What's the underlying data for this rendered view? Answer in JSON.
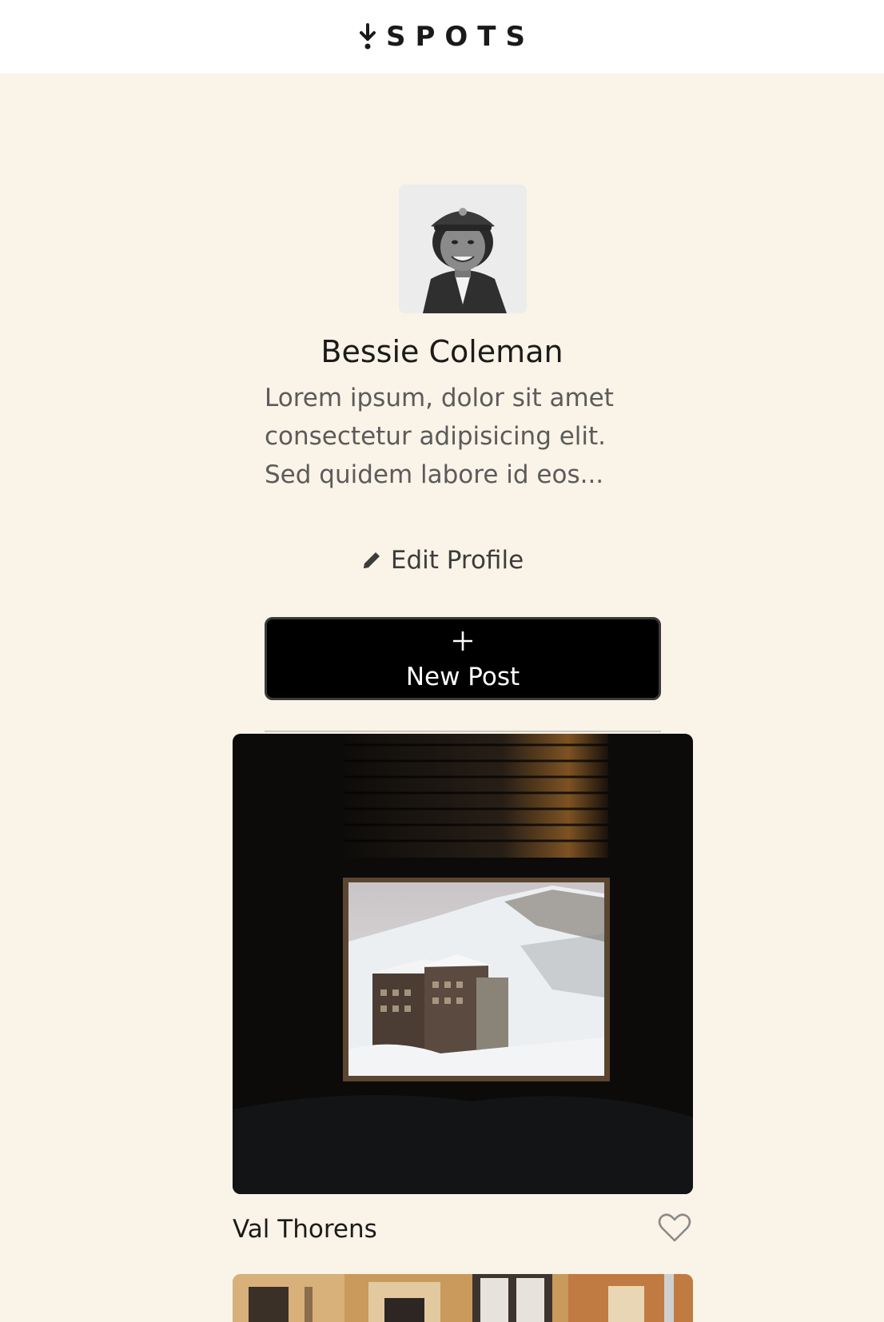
{
  "header": {
    "logo_text": "SPOTS",
    "logo_icon": "down-arrow-pin-icon"
  },
  "profile": {
    "name": "Bessie Coleman",
    "bio": "Lorem ipsum, dolor sit amet consectetur adipisicing elit. Sed quidem labore id eos...",
    "avatar_icon": "avatar-photo",
    "edit_label": "Edit Profile",
    "edit_icon": "pencil-icon"
  },
  "actions": {
    "new_post_label": "New Post",
    "new_post_icon": "plus-icon"
  },
  "cards": [
    {
      "title": "Val Thorens",
      "like_icon": "heart-outline-icon",
      "liked": false
    },
    {
      "title": "",
      "like_icon": "heart-outline-icon"
    }
  ],
  "colors": {
    "page_background": "#FAF3E7",
    "header_background": "#FFFFFF",
    "button_background": "#000000",
    "text_primary": "#1b1b1b",
    "text_secondary": "#5b5b5b"
  }
}
